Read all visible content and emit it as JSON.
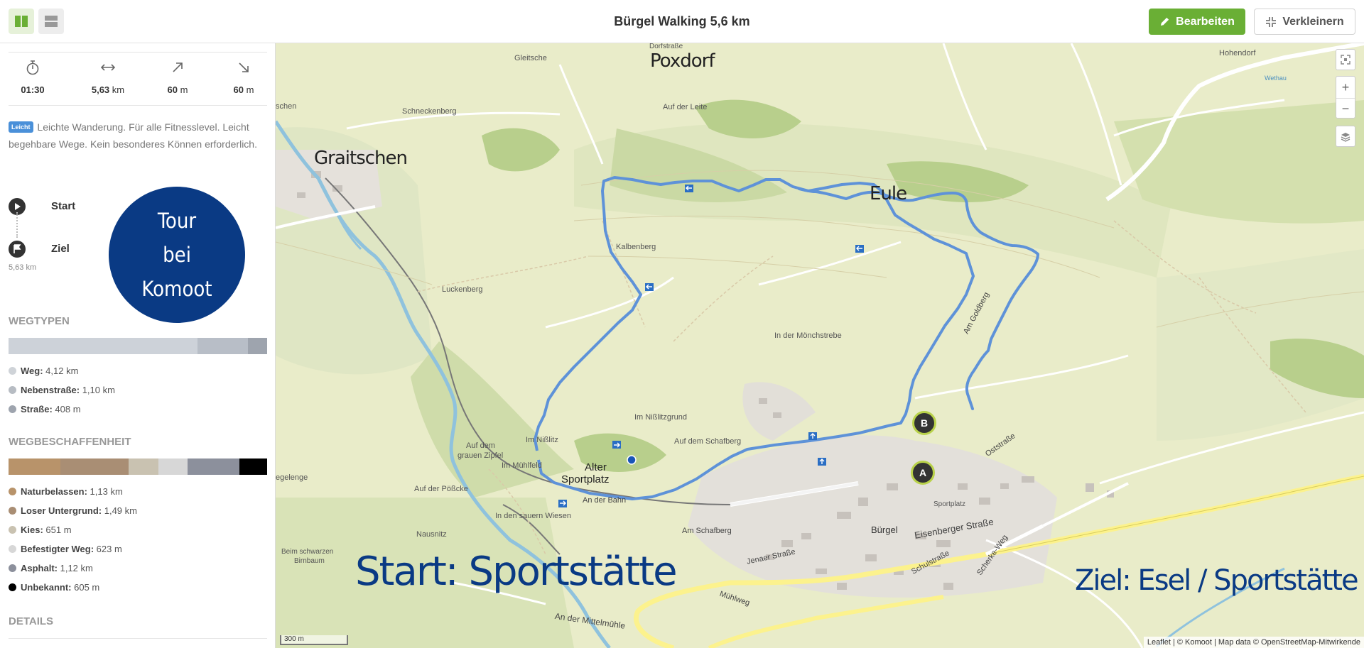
{
  "header": {
    "title": "Bürgel Walking 5,6 km",
    "edit_label": "Bearbeiten",
    "shrink_label": "Verkleinern"
  },
  "stats": {
    "duration": "01:30",
    "distance_value": "5,63",
    "distance_unit": "km",
    "ascent_value": "60",
    "ascent_unit": "m",
    "descent_value": "60",
    "descent_unit": "m"
  },
  "difficulty": {
    "badge": "Leicht",
    "text": "Leichte Wanderung. Für alle Fitnesslevel. Leicht begehbare Wege. Kein besonderes Können erforderlich."
  },
  "waypoints": {
    "start": "Start",
    "end": "Ziel",
    "distance": "5,63 km"
  },
  "tour_circle": {
    "line1": "Tour",
    "line2": "bei",
    "line3": "Komoot"
  },
  "wegtypen": {
    "heading": "WEGTYPEN",
    "segments": [
      {
        "color": "#cdd2d9",
        "share": 0.732
      },
      {
        "color": "#b8bec7",
        "share": 0.195
      },
      {
        "color": "#9ea4ae",
        "share": 0.073
      }
    ],
    "items": [
      {
        "label": "Weg:",
        "value": "4,12 km",
        "color": "#cfd3d8"
      },
      {
        "label": "Nebenstraße:",
        "value": "1,10 km",
        "color": "#b7bcc3"
      },
      {
        "label": "Straße:",
        "value": "408 m",
        "color": "#9ea4ae"
      }
    ]
  },
  "wegbeschaffenheit": {
    "heading": "WEGBESCHAFFENHEIT",
    "segments": [
      {
        "color": "#b8936a",
        "share": 0.2
      },
      {
        "color": "#a98e74",
        "share": 0.265
      },
      {
        "color": "#c9c2b1",
        "share": 0.116
      },
      {
        "color": "#d7d7d7",
        "share": 0.111
      },
      {
        "color": "#8c909c",
        "share": 0.2
      },
      {
        "color": "#000000",
        "share": 0.108
      }
    ],
    "items": [
      {
        "label": "Naturbelassen:",
        "value": "1,13 km",
        "color": "#b8936a"
      },
      {
        "label": "Loser Untergrund:",
        "value": "1,49 km",
        "color": "#a98e74"
      },
      {
        "label": "Kies:",
        "value": "651 m",
        "color": "#c9c2b1"
      },
      {
        "label": "Befestigter Weg:",
        "value": "623 m",
        "color": "#d7d7d7"
      },
      {
        "label": "Asphalt:",
        "value": "1,12 km",
        "color": "#8c909c"
      },
      {
        "label": "Unbekannt:",
        "value": "605 m",
        "color": "#000000"
      }
    ]
  },
  "details_heading": "DETAILS",
  "map": {
    "towns": {
      "poxdorf": "Poxdorf",
      "graitschen": "Graitschen",
      "eule": "Eule"
    },
    "places": {
      "gleitsche": "Gleitsche",
      "dorfstrasse": "Dorfstraße",
      "hohendorf": "Hohendorf",
      "schneckenberg": "Schneckenberg",
      "auf_der_leite": "Auf der Leite",
      "kalbenberg": "Kalbenberg",
      "luckenberg": "Luckenberg",
      "in_der_moenchstrebe": "In der Mönchstrebe",
      "im_nisslitzgrund": "Im Nißlitzgrund",
      "auf_dem_schafberg": "Auf dem Schafberg",
      "im_nisslitz": "Im Nißlitz",
      "auf_dem_grauen_zipfel_1": "Auf dem",
      "auf_dem_grauen_zipfel_2": "grauen Zipfel",
      "im_muehlfeld": "Im Mühlfeld",
      "alter_sportplatz_1": "Alter",
      "alter_sportplatz_2": "Sportplatz",
      "auf_der_poesske": "Auf der Pößcke",
      "in_den_sauern_wiesen": "In den sauern Wiesen",
      "nausnitz": "Nausnitz",
      "beim_schwarzen_birnbaum_1": "Beim schwarzen",
      "beim_schwarzen_birnbaum_2": "Birnbaum",
      "buergel": "Bürgel",
      "sportplatz": "Sportplatz",
      "schen": "schen",
      "gelenge": "egelenge"
    },
    "streets": {
      "am_goldberg": "Am Goldberg",
      "oststrasse": "Oststraße",
      "an_der_bahn": "An der Bahn",
      "am_schafberg": "Am Schafberg",
      "jenaer_strasse": "Jenaer Straße",
      "eisenberger_strasse": "Eisenberger Straße",
      "schulstrasse": "Schulstraße",
      "scherke_weg": "Scherke-Weg",
      "muehlweg": "Mühlweg",
      "an_der_mittelmuehle": "An der Mittelmühle",
      "wethau": "Wethau"
    },
    "overlay_start": "Start: Sportstätte",
    "overlay_end": "Ziel: Esel / Sportstätte",
    "marker_a": "A",
    "marker_b": "B",
    "zoom_in": "+",
    "zoom_out": "−",
    "scale": "300 m",
    "attribution": "Leaflet | © Komoot | Map data © OpenStreetMap-Mitwirkende"
  }
}
